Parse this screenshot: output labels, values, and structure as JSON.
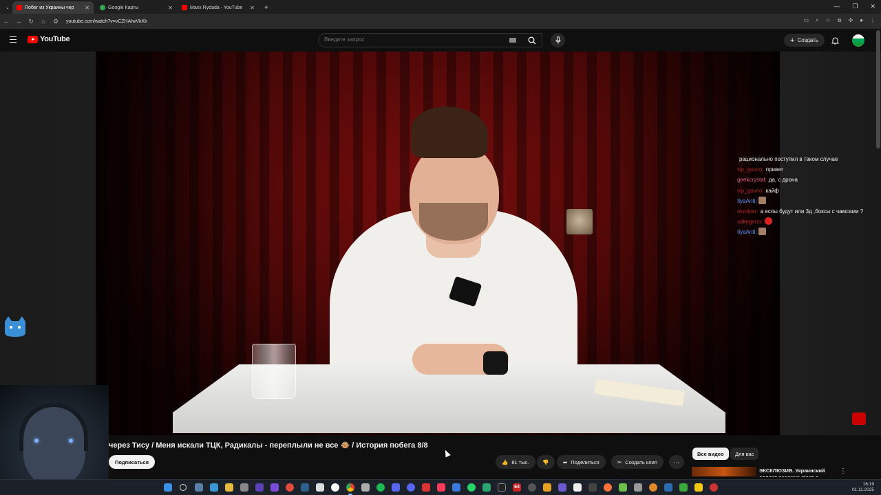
{
  "browser": {
    "tabs": [
      {
        "label": "Побег из Украины чер",
        "favicon_color": "#ff0000",
        "active": true
      },
      {
        "label": "Google Карты",
        "favicon_color": "#34a853",
        "active": false
      },
      {
        "label": "Maxx Rydada - YouTube",
        "favicon_color": "#ff0000",
        "active": false
      }
    ],
    "new_tab": "+",
    "url": "youtube.com/watch?v=vCZHAIwVkKk"
  },
  "youtube": {
    "logo_text": "YouTube",
    "search_placeholder": "Введите запрос",
    "create_label": "Создать"
  },
  "chat": [
    {
      "user": "",
      "message": "рационально поступил в таком случае",
      "user_color": "#ffffff"
    },
    {
      "user": "vip_govno:",
      "message": "привет",
      "user_color": "#b22222"
    },
    {
      "user": "geekcrystal:",
      "message": "да, с дрона",
      "user_color": "#e05a8a"
    },
    {
      "user": "vip_govno:",
      "message": "кайф",
      "user_color": "#b22222"
    },
    {
      "user": "IlyaAnti:",
      "message": "",
      "user_color": "#5b9bff",
      "emote": "face"
    },
    {
      "user": "rezolver:",
      "message": "а еспы будут или 3д ,боксы с чамсами ?",
      "user_color": "#b22222"
    },
    {
      "user": "sdkegeno:",
      "message": "",
      "user_color": "#b22222",
      "emote": "red"
    },
    {
      "user": "IlyaAnti:",
      "message": "",
      "user_color": "#5b9bff",
      "emote": "face"
    }
  ],
  "video": {
    "title": "через Тису / Меня искали ТЦК, Радикалы - переплыли не все 🐵 / История побега 8/8",
    "subscribe_label": "Подписаться",
    "likes_label": "81 тыс.",
    "share_label": "Поделиться",
    "clip_label": "Создать клип",
    "more_label": "⋯"
  },
  "sidebar": {
    "chips": [
      "Все видео",
      "Для вас"
    ],
    "recommendation_title": "ЭКСКЛЮЗИВ. Украинский солдат рассказывает о"
  },
  "taskbar": {
    "time": "16:19",
    "date": "01.11.2025",
    "badge": "64"
  }
}
